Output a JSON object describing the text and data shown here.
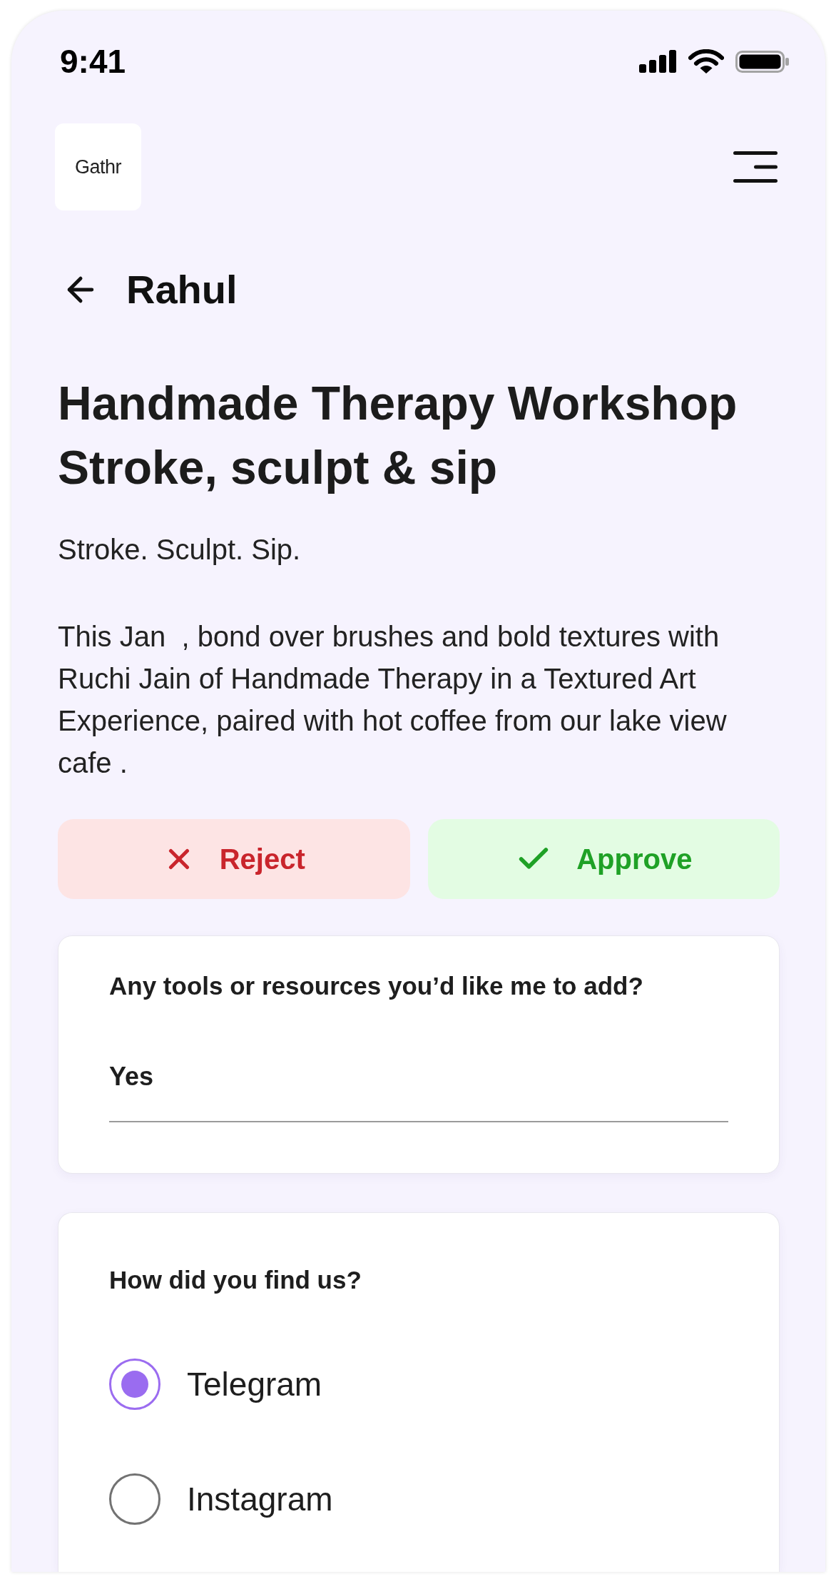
{
  "status_bar": {
    "time": "9:41"
  },
  "header": {
    "logo": "Gathr"
  },
  "back": {
    "label": "Rahul"
  },
  "event": {
    "title": "Handmade Therapy Workshop Stroke, sculpt & sip",
    "tagline": "Stroke. Sculpt. Sip.",
    "description": "This Jan  , bond over brushes and bold textures with Ruchi Jain of Handmade Therapy in a Textured Art Experience, paired with hot coffee from our lake view  cafe ."
  },
  "actions": [
    {
      "kind": "reject",
      "label": "Reject"
    },
    {
      "kind": "approve",
      "label": "Approve"
    }
  ],
  "questions": [
    {
      "kind": "text",
      "question": "Any tools or resources you’d like me to add?",
      "value": "Yes"
    },
    {
      "kind": "choice",
      "question": "How did you find us?",
      "options": [
        {
          "label": "Telegram",
          "selected": true
        },
        {
          "label": "Instagram",
          "selected": false
        }
      ]
    }
  ]
}
